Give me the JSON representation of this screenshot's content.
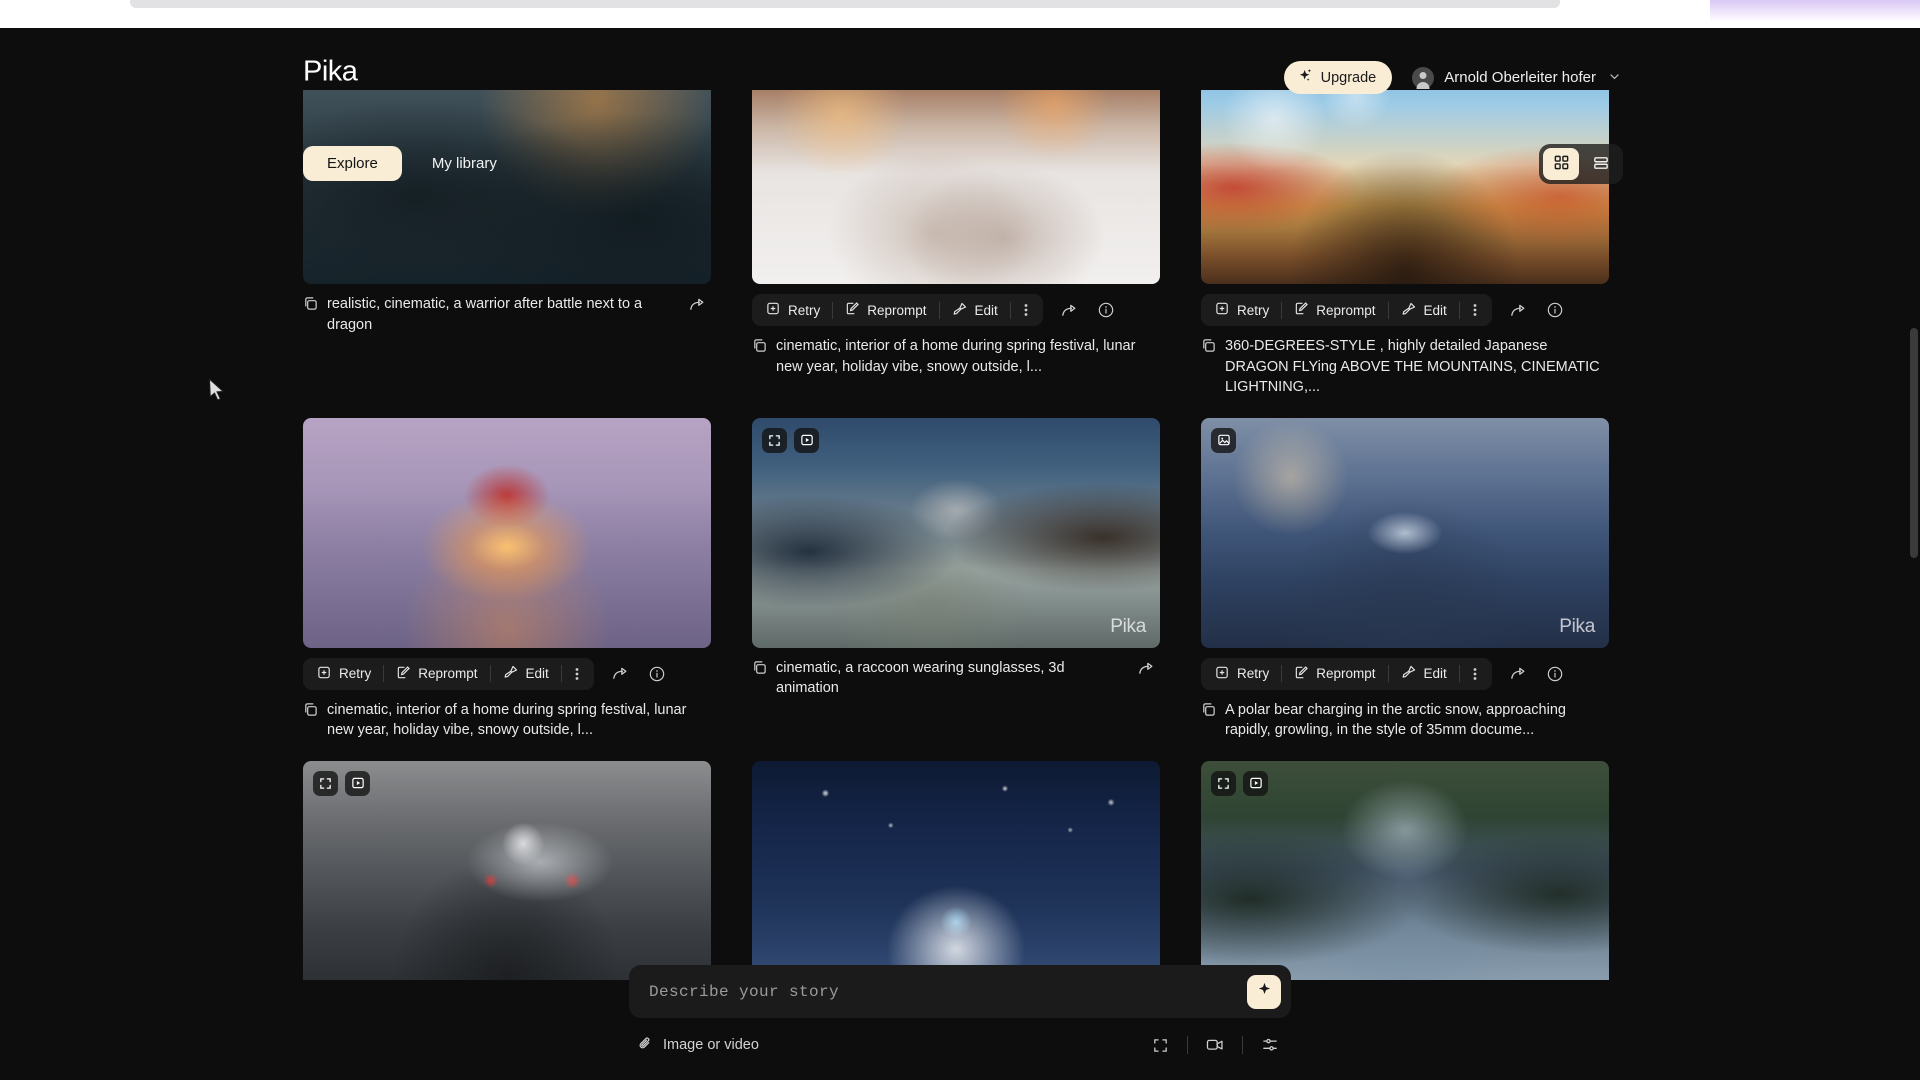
{
  "app": {
    "logo": "Pika",
    "background": "#0d0d0d",
    "accent": "#faedd5"
  },
  "header": {
    "upgrade_label": "Upgrade",
    "upgrade_icon": "sparkle-icon",
    "user_name": "Arnold Oberleiter hofer",
    "chevron": "⌄"
  },
  "tabs": [
    {
      "label": "Explore",
      "active": true
    },
    {
      "label": "My library",
      "active": false
    }
  ],
  "view_toggle": {
    "grid_label": "grid-view",
    "list_label": "list-view",
    "active": "grid"
  },
  "actions": {
    "retry": "Retry",
    "reprompt": "Reprompt",
    "edit": "Edit",
    "more": "⋮"
  },
  "cards": [
    {
      "id": "card-warrior",
      "art": "art-warrior",
      "overlays": [],
      "watermark": "",
      "has_actions": false,
      "prompt": "realistic, cinematic, a warrior after battle next to a dragon"
    },
    {
      "id": "card-village",
      "art": "art-village",
      "overlays": [],
      "watermark": "",
      "has_actions": true,
      "prompt": "cinematic, interior of a home during spring festival, lunar new year, holiday vibe, snowy outside, l..."
    },
    {
      "id": "card-dragon",
      "art": "art-dragon",
      "overlays": [],
      "watermark": "",
      "has_actions": true,
      "prompt": "360-DEGREES-STYLE , highly detailed Japanese DRAGON FLYing ABOVE THE MOUNTAINS, CINEMATIC LIGHTNING,..."
    },
    {
      "id": "card-lantern",
      "art": "art-lantern",
      "overlays": [],
      "watermark": "",
      "has_actions": true,
      "prompt": "cinematic, interior of a home during spring festival, lunar new year, holiday vibe, snowy outside, l..."
    },
    {
      "id": "card-raccoon",
      "art": "art-raccoon",
      "overlays": [
        "expand-icon",
        "play-video-icon"
      ],
      "watermark": "Pika",
      "has_actions": false,
      "prompt": "cinematic, a raccoon wearing sunglasses, 3d animation"
    },
    {
      "id": "card-polarbear",
      "art": "art-polarbear",
      "overlays": [
        "image-icon"
      ],
      "watermark": "Pika",
      "has_actions": true,
      "prompt": "A polar bear charging in the arctic snow, approaching rapidly, growling, in the style of 35mm docume..."
    },
    {
      "id": "card-spaceship",
      "art": "art-spaceship",
      "overlays": [
        "expand-icon",
        "play-video-icon"
      ],
      "watermark": "",
      "has_actions": false,
      "prompt": ""
    },
    {
      "id": "card-robot",
      "art": "art-robot",
      "overlays": [],
      "watermark": "",
      "has_actions": false,
      "prompt": ""
    },
    {
      "id": "card-fjord",
      "art": "art-fjord",
      "overlays": [
        "expand-icon",
        "play-video-icon"
      ],
      "watermark": "",
      "has_actions": false,
      "prompt": ""
    }
  ],
  "composer": {
    "placeholder": "Describe your story",
    "value": "",
    "generate_icon": "sparkle-icon",
    "attach_label": "Image or video",
    "tools": [
      "aspect-ratio-icon",
      "video-camera-icon",
      "settings-sliders-icon"
    ]
  }
}
